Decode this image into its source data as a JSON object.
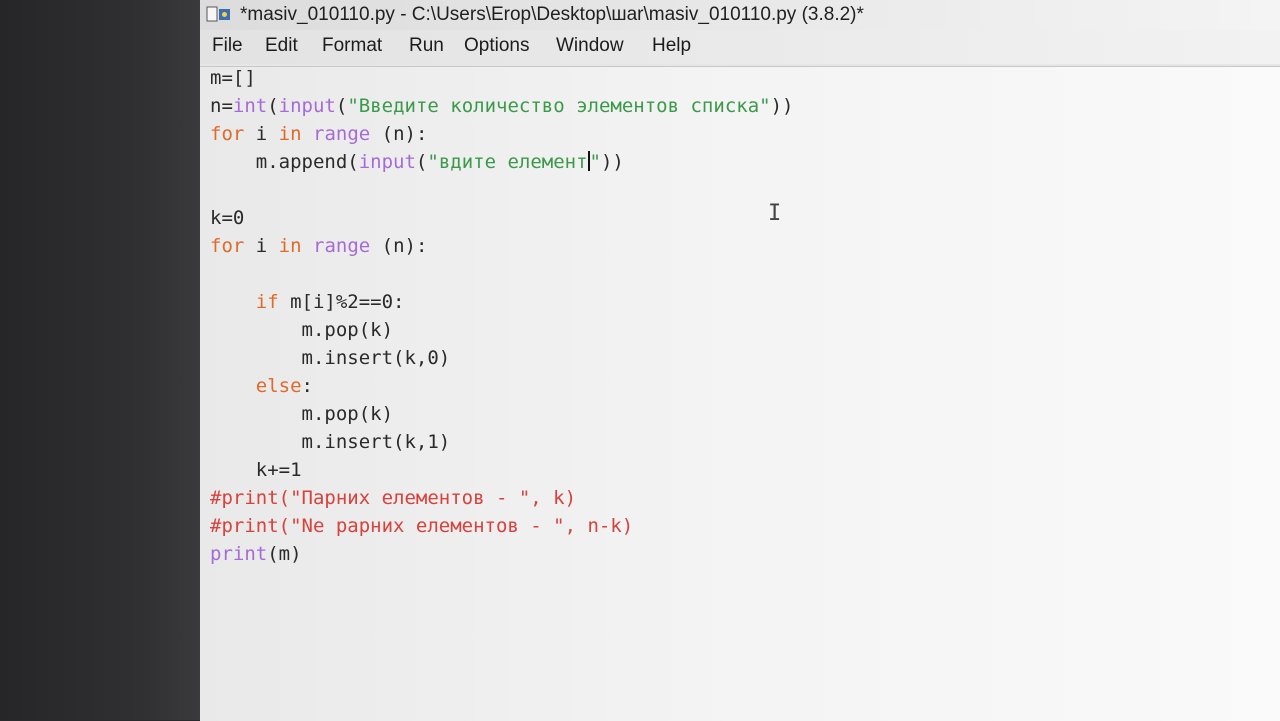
{
  "window": {
    "title": "*masiv_010110.py - C:\\Users\\Erop\\Desktop\\шаr\\masiv_010110.py (3.8.2)*",
    "icon": "python-file-icon"
  },
  "menu": [
    "File",
    "Edit",
    "Format",
    "Run",
    "Options",
    "Window",
    "Help"
  ],
  "code": {
    "lines": [
      {
        "indent": "",
        "tokens": [
          {
            "t": "m=[]",
            "c": "def"
          }
        ]
      },
      {
        "indent": "",
        "tokens": [
          {
            "t": "n=",
            "c": "def"
          },
          {
            "t": "int",
            "c": "bi"
          },
          {
            "t": "(",
            "c": "def"
          },
          {
            "t": "input",
            "c": "bi"
          },
          {
            "t": "(",
            "c": "def"
          },
          {
            "t": "\"Введите количество элементов списка\"",
            "c": "str"
          },
          {
            "t": "))",
            "c": "def"
          }
        ]
      },
      {
        "indent": "",
        "tokens": [
          {
            "t": "for",
            "c": "kw"
          },
          {
            "t": " i ",
            "c": "def"
          },
          {
            "t": "in",
            "c": "kw"
          },
          {
            "t": " ",
            "c": "def"
          },
          {
            "t": "range",
            "c": "bi"
          },
          {
            "t": " (n):",
            "c": "def"
          }
        ]
      },
      {
        "indent": "    ",
        "tokens": [
          {
            "t": "m.append(",
            "c": "def"
          },
          {
            "t": "input",
            "c": "bi"
          },
          {
            "t": "(",
            "c": "def"
          },
          {
            "t": "\"вдите елемент",
            "c": "str"
          },
          {
            "t": "|",
            "c": "caret"
          },
          {
            "t": "\"",
            "c": "str"
          },
          {
            "t": "))",
            "c": "def"
          }
        ]
      },
      {
        "indent": "",
        "tokens": []
      },
      {
        "indent": "",
        "tokens": [
          {
            "t": "k=0",
            "c": "def"
          }
        ]
      },
      {
        "indent": "",
        "tokens": [
          {
            "t": "for",
            "c": "kw"
          },
          {
            "t": " i ",
            "c": "def"
          },
          {
            "t": "in",
            "c": "kw"
          },
          {
            "t": " ",
            "c": "def"
          },
          {
            "t": "range",
            "c": "bi"
          },
          {
            "t": " (n):",
            "c": "def"
          }
        ]
      },
      {
        "indent": "",
        "tokens": []
      },
      {
        "indent": "    ",
        "tokens": [
          {
            "t": "if",
            "c": "kw"
          },
          {
            "t": " m[i]%2==0:",
            "c": "def"
          }
        ]
      },
      {
        "indent": "        ",
        "tokens": [
          {
            "t": "m.pop(k)",
            "c": "def"
          }
        ]
      },
      {
        "indent": "        ",
        "tokens": [
          {
            "t": "m.insert(k,0)",
            "c": "def"
          }
        ]
      },
      {
        "indent": "    ",
        "tokens": [
          {
            "t": "else",
            "c": "kw"
          },
          {
            "t": ":",
            "c": "def"
          }
        ]
      },
      {
        "indent": "        ",
        "tokens": [
          {
            "t": "m.pop(k)",
            "c": "def"
          }
        ]
      },
      {
        "indent": "        ",
        "tokens": [
          {
            "t": "m.insert(k,1)",
            "c": "def"
          }
        ]
      },
      {
        "indent": "    ",
        "tokens": [
          {
            "t": "k+=1",
            "c": "def"
          }
        ]
      },
      {
        "indent": "",
        "tokens": [
          {
            "t": "#print(\"Парних елементов - \", k)",
            "c": "cmt"
          }
        ]
      },
      {
        "indent": "",
        "tokens": [
          {
            "t": "#print(\"Ne рарних елементов - \", n-k)",
            "c": "cmt"
          }
        ]
      },
      {
        "indent": "",
        "tokens": [
          {
            "t": "print",
            "c": "bi"
          },
          {
            "t": "(m)",
            "c": "def"
          }
        ]
      }
    ]
  },
  "colors": {
    "keyword": "#e06a2a",
    "builtin": "#a56bd6",
    "string": "#3a9a4a",
    "comment": "#d8413c",
    "default": "#2a2a2a"
  }
}
